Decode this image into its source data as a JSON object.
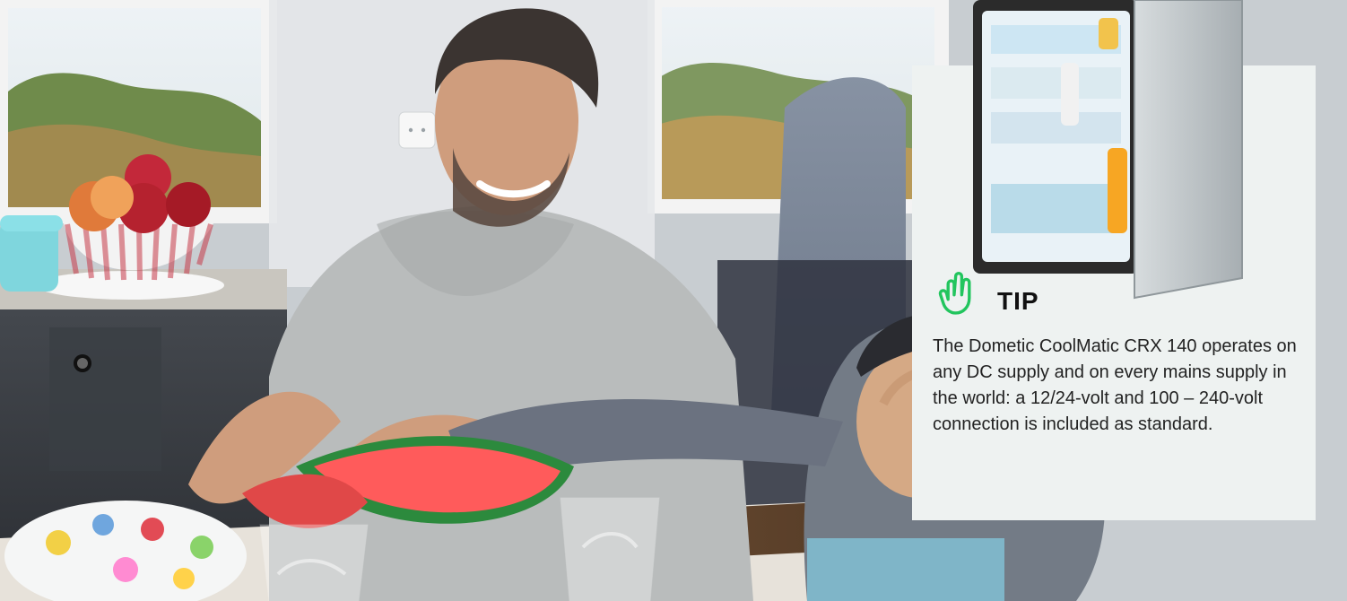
{
  "tip": {
    "label": "TIP",
    "text": "The Dometic CoolMatic CRX 140 operates on any DC supply and on every mains supply in the world: a 12/24-volt and 100 – 240-volt connection is included as standard."
  },
  "colors": {
    "card_background": "#eef2f1",
    "tip_icon": "#22c55e",
    "heading": "#111111",
    "body_text": "#222222"
  },
  "icons": {
    "tip_icon": "hand-pointing-up-icon"
  }
}
